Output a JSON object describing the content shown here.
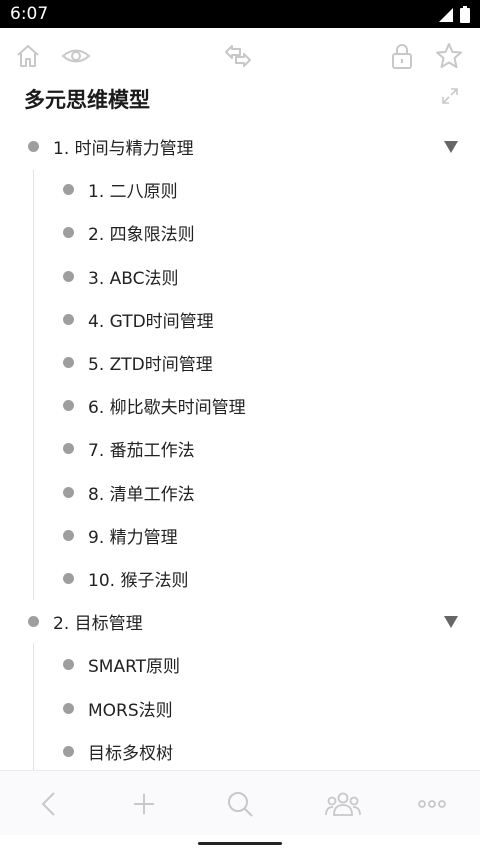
{
  "status": {
    "time": "6:07"
  },
  "note": {
    "title": "多元思维模型"
  },
  "outline": [
    {
      "label": "1. 时间与精力管理",
      "level": 1,
      "collapsible": true
    },
    {
      "label": "1. 二八原则",
      "level": 2
    },
    {
      "label": "2. 四象限法则",
      "level": 2
    },
    {
      "label": "3. ABC法则",
      "level": 2
    },
    {
      "label": "4. GTD时间管理",
      "level": 2
    },
    {
      "label": "5. ZTD时间管理",
      "level": 2
    },
    {
      "label": "6. 柳比歇夫时间管理",
      "level": 2
    },
    {
      "label": "7. 番茄工作法",
      "level": 2
    },
    {
      "label": "8. 清单工作法",
      "level": 2
    },
    {
      "label": "9. 精力管理",
      "level": 2
    },
    {
      "label": "10. 猴子法则",
      "level": 2
    },
    {
      "label": "2. 目标管理",
      "level": 1,
      "collapsible": true
    },
    {
      "label": "SMART原则",
      "level": 2
    },
    {
      "label": "MORS法则",
      "level": 2
    },
    {
      "label": "目标多杈树",
      "level": 2
    }
  ],
  "icons": {
    "toolbar": [
      "home-icon",
      "eye-icon",
      "swap-arrows-icon",
      "lock-icon",
      "star-icon"
    ],
    "bottom": [
      "back-icon",
      "add-icon",
      "search-icon",
      "collaborators-icon",
      "more-icon"
    ]
  },
  "colors": {
    "bullet": "#9e9e9e",
    "icon": "#c8c8c8",
    "text": "#222222"
  }
}
